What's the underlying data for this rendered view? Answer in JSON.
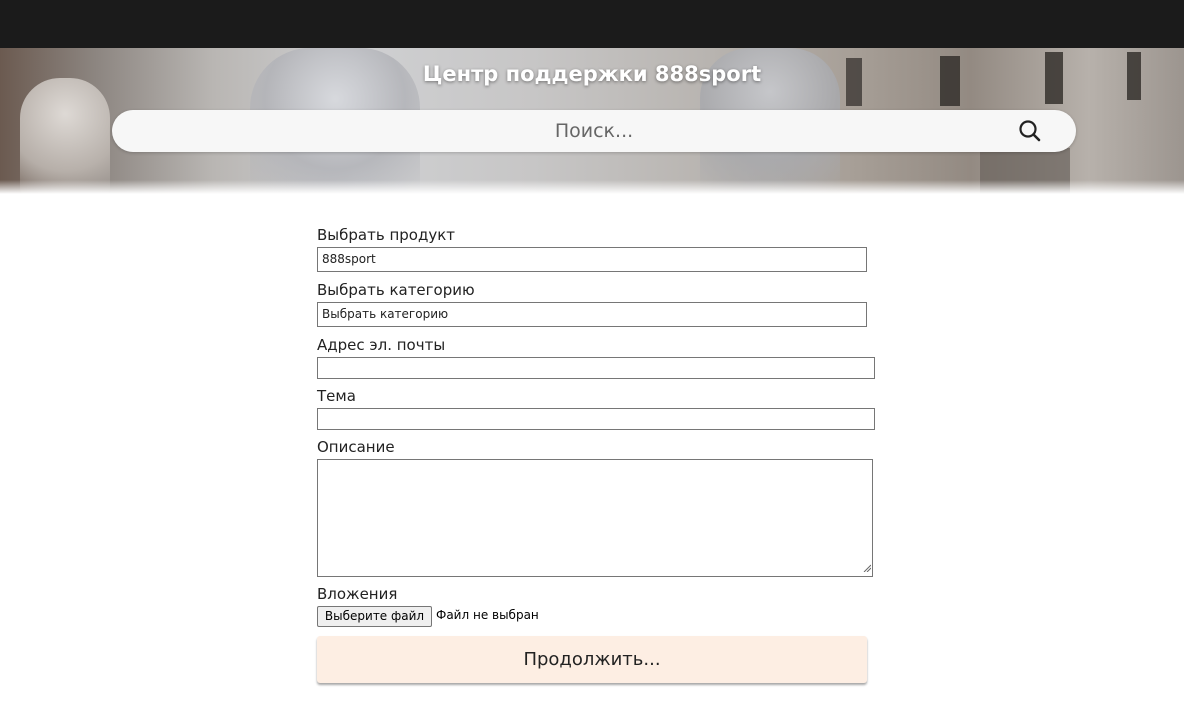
{
  "header": {
    "title": "Центр поддержки 888sport"
  },
  "search": {
    "placeholder": "Поиск...",
    "icon": "search-icon"
  },
  "form": {
    "product": {
      "label": "Выбрать продукт",
      "value": "888sport"
    },
    "category": {
      "label": "Выбрать категорию",
      "value": "Выбрать категорию"
    },
    "email": {
      "label": "Адрес эл. почты",
      "value": ""
    },
    "subject": {
      "label": "Тема",
      "value": ""
    },
    "description": {
      "label": "Описание",
      "value": ""
    },
    "attachments": {
      "label": "Вложения",
      "button_label": "Выберите файл",
      "status": "Файл не выбран"
    },
    "submit_label": "Продолжить..."
  },
  "colors": {
    "topbar": "#1b1b1b",
    "submit_background": "#fdeee3",
    "title_text": "#ffffff"
  }
}
